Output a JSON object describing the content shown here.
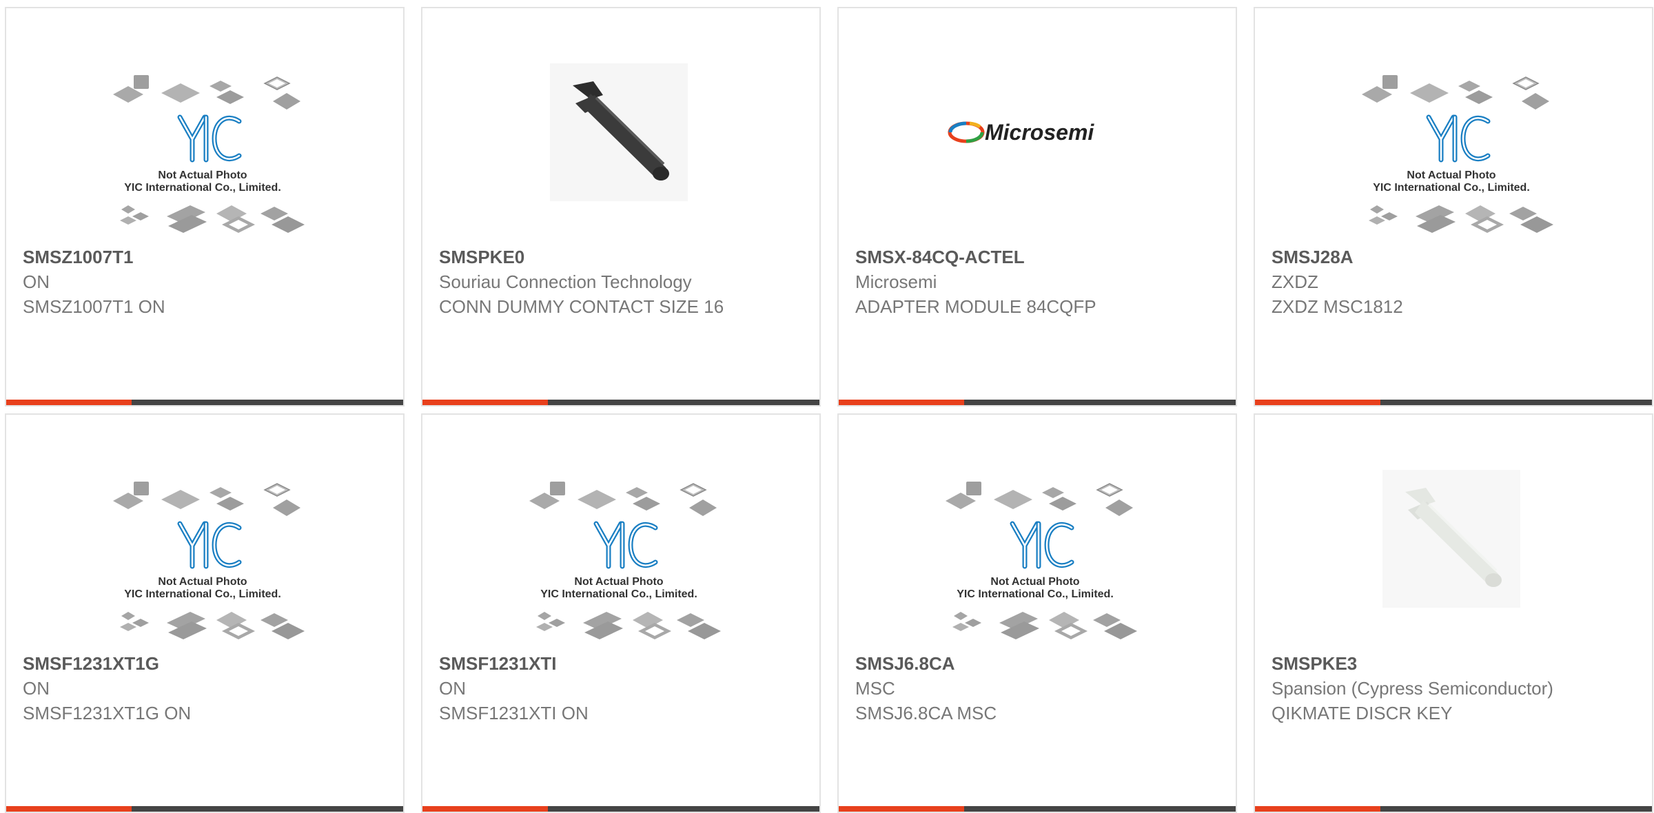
{
  "theme": {
    "accent": "#e8401c",
    "bar_dark": "#444444",
    "yic_blue": "#1a7fc3"
  },
  "placeholder": {
    "line1": "Not Actual Photo",
    "line2": "YIC International Co., Limited."
  },
  "microsemi_logo_text": "Microsemi",
  "products": [
    {
      "part": "SMSZ1007T1",
      "manufacturer": "ON",
      "description": "SMSZ1007T1 ON",
      "image": "yic-placeholder"
    },
    {
      "part": "SMSPKE0",
      "manufacturer": "Souriau Connection Technology",
      "description": "CONN DUMMY CONTACT SIZE 16",
      "image": "dark-pin-photo"
    },
    {
      "part": "SMSX-84CQ-ACTEL",
      "manufacturer": "Microsemi",
      "description": "ADAPTER MODULE 84CQFP",
      "image": "microsemi-logo"
    },
    {
      "part": "SMSJ28A",
      "manufacturer": "ZXDZ",
      "description": "ZXDZ MSC1812",
      "image": "yic-placeholder"
    },
    {
      "part": "SMSF1231XT1G",
      "manufacturer": "ON",
      "description": "SMSF1231XT1G ON",
      "image": "yic-placeholder"
    },
    {
      "part": "SMSF1231XTI",
      "manufacturer": "ON",
      "description": "SMSF1231XTI ON",
      "image": "yic-placeholder"
    },
    {
      "part": "SMSJ6.8CA",
      "manufacturer": "MSC",
      "description": "SMSJ6.8CA MSC",
      "image": "yic-placeholder"
    },
    {
      "part": "SMSPKE3",
      "manufacturer": "Spansion (Cypress Semiconductor)",
      "description": "QIKMATE DISCR KEY",
      "image": "white-pin-photo"
    }
  ]
}
